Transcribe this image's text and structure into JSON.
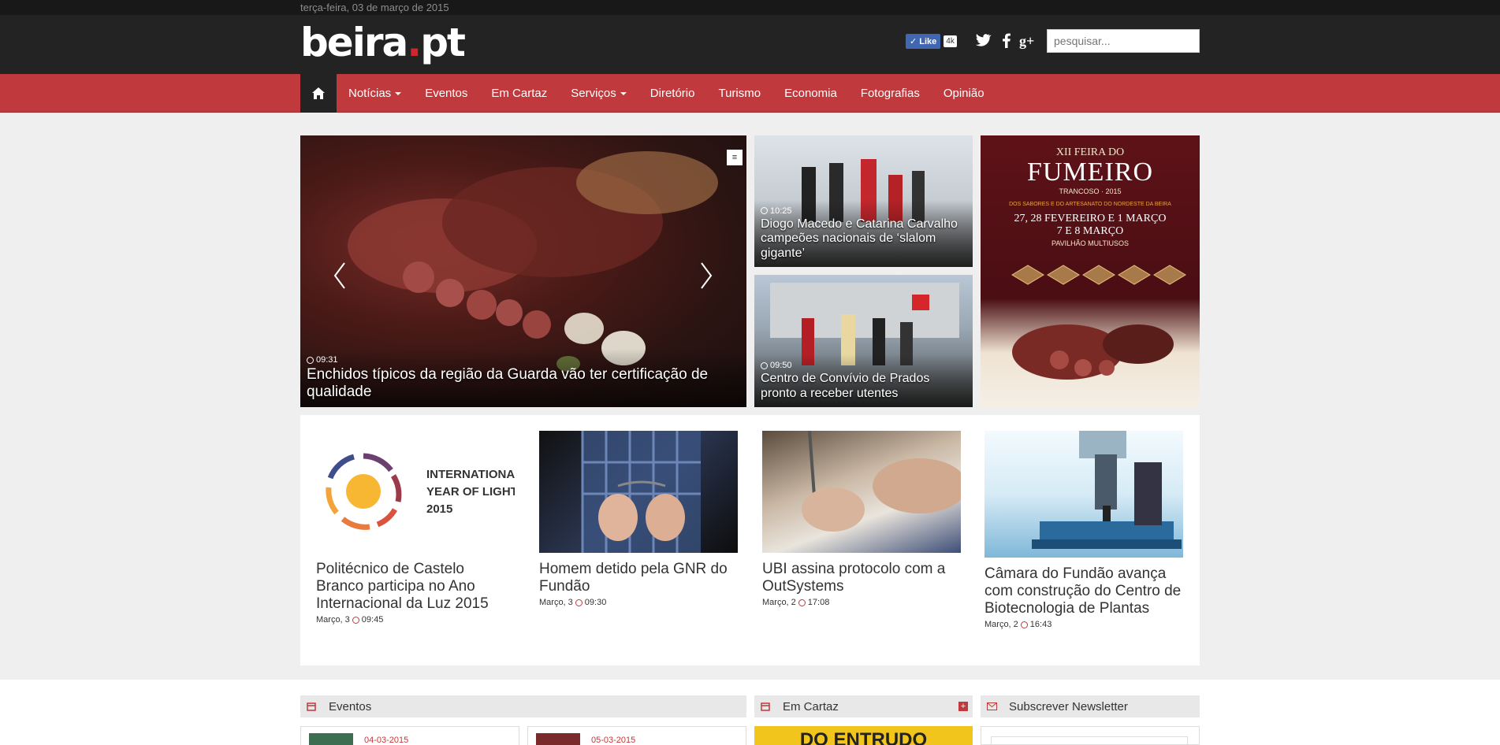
{
  "topbar": {
    "date": "terça-feira, 03 de março de 2015"
  },
  "header": {
    "logo_main": "beira",
    "logo_dot": ".",
    "logo_tld": "pt",
    "fb_like_label": "Like",
    "fb_like_count": "4k",
    "search_placeholder": "pesquisar..."
  },
  "nav": {
    "home_icon": "home-icon",
    "items": [
      {
        "label": "Notícias",
        "dropdown": true
      },
      {
        "label": "Eventos",
        "dropdown": false
      },
      {
        "label": "Em Cartaz",
        "dropdown": false
      },
      {
        "label": "Serviços",
        "dropdown": true
      },
      {
        "label": "Diretório",
        "dropdown": false
      },
      {
        "label": "Turismo",
        "dropdown": false
      },
      {
        "label": "Economia",
        "dropdown": false
      },
      {
        "label": "Fotografias",
        "dropdown": false
      },
      {
        "label": "Opinião",
        "dropdown": false
      }
    ]
  },
  "featured": {
    "main": {
      "time": "09:31",
      "title": "Enchidos típicos da região da Guarda vão ter certificação de qualidade"
    },
    "side1": {
      "time": "10:25",
      "title": "Diogo Macedo e Catarina Carvalho campeões nacionais de ‘slalom gigante’"
    },
    "side2": {
      "time": "09:50",
      "title": "Centro de Convívio de Prados pronto a receber utentes"
    },
    "ad": {
      "line1": "XII FEIRA DO",
      "line2": "FUMEIRO",
      "line3": "TRANCOSO · 2015",
      "line4": "DOS SABORES E DO ARTESANATO DO NORDESTE DA BEIRA",
      "line5": "27, 28 FEVEREIRO E 1 MARÇO",
      "line6": "7 E 8 MARÇO",
      "line7": "PAVILHÃO MULTIUSOS"
    }
  },
  "news": [
    {
      "title": "Politécnico de Castelo Branco participa no Ano Internacional da Luz 2015",
      "date": "Março, 3",
      "time": "09:45",
      "thumb_text": [
        "INTERNATIONAL",
        "YEAR OF LIGHT",
        "2015"
      ]
    },
    {
      "title": "Homem detido pela GNR do Fundão",
      "date": "Março, 3",
      "time": "09:30"
    },
    {
      "title": "UBI assina protocolo com a OutSystems",
      "date": "Março, 2",
      "time": "17:08"
    },
    {
      "title": "Câmara do Fundão avança com construção do Centro de Biotecnologia de Plantas",
      "date": "Março, 2",
      "time": "16:43"
    }
  ],
  "widgets": {
    "eventos": {
      "title": "Eventos",
      "cards": [
        {
          "date": "04-03-2015"
        },
        {
          "date": "05-03-2015"
        }
      ]
    },
    "cartaz": {
      "title": "Em Cartaz",
      "banner": "DO ENTRUDO"
    },
    "newsletter": {
      "title": "Subscrever Newsletter"
    }
  },
  "colors": {
    "brand_red": "#c0393d",
    "dark": "#232323"
  }
}
